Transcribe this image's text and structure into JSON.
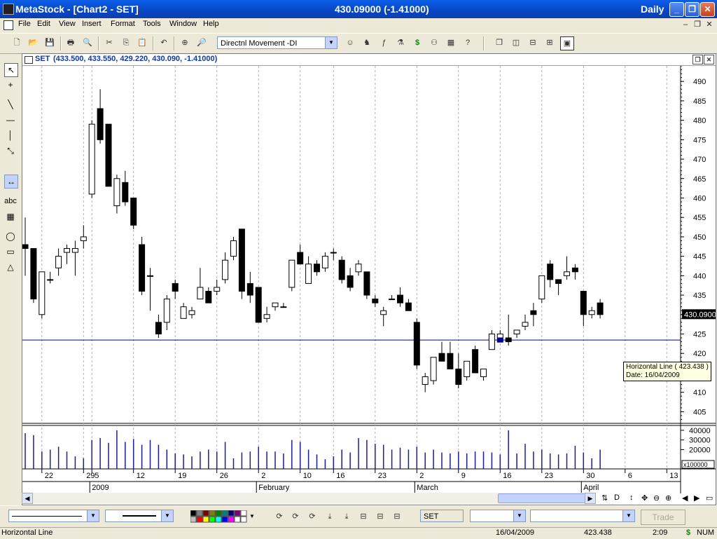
{
  "window": {
    "app_title": "MetaStock - [Chart2 - SET]",
    "center_title": "430.09000 (-1.41000)",
    "periodicity": "Daily"
  },
  "menu": [
    "File",
    "Edit",
    "View",
    "Insert",
    "Format",
    "Tools",
    "Window",
    "Help"
  ],
  "toolbar": {
    "indicator_select": "Directnl Movement -DI"
  },
  "chart_header": {
    "symbol": "SET",
    "ohlc": "(433.500, 433.550, 429.220, 430.090, -1.41000)"
  },
  "chart_data": {
    "type": "candlestick",
    "price_axis": {
      "min": 402,
      "max": 494,
      "ticks": [
        405,
        410,
        415,
        420,
        425,
        430,
        435,
        440,
        445,
        450,
        455,
        460,
        465,
        470,
        475,
        480,
        485,
        490
      ]
    },
    "volume_axis": {
      "ticks_labels": [
        "40000",
        "30000",
        "20000"
      ],
      "unit": "x100000"
    },
    "last_price_label": "430.0900",
    "horizontal_line": 423.438,
    "x_day_labels": [
      "22",
      "29",
      "5",
      "12",
      "19",
      "26",
      "2",
      "10",
      "16",
      "23",
      "2",
      "9",
      "16",
      "23",
      "30",
      "6",
      "13"
    ],
    "x_month_labels": [
      "2009",
      "February",
      "March",
      "April"
    ],
    "candles": [
      {
        "o": 448,
        "h": 455,
        "l": 440,
        "c": 447
      },
      {
        "o": 447,
        "h": 447,
        "l": 433,
        "c": 434
      },
      {
        "o": 430,
        "h": 441,
        "l": 429,
        "c": 441
      },
      {
        "o": 439,
        "h": 441,
        "l": 438,
        "c": 439
      },
      {
        "o": 442,
        "h": 447,
        "l": 440,
        "c": 445
      },
      {
        "o": 446,
        "h": 448,
        "l": 443,
        "c": 447
      },
      {
        "o": 446,
        "h": 449,
        "l": 440,
        "c": 447
      },
      {
        "o": 449,
        "h": 453,
        "l": 447,
        "c": 450
      },
      {
        "o": 461,
        "h": 480,
        "l": 460,
        "c": 479
      },
      {
        "o": 483,
        "h": 488,
        "l": 474,
        "c": 475
      },
      {
        "o": 479,
        "h": 479,
        "l": 463,
        "c": 463
      },
      {
        "o": 458,
        "h": 466,
        "l": 456,
        "c": 465
      },
      {
        "o": 464,
        "h": 467,
        "l": 458,
        "c": 459
      },
      {
        "o": 460,
        "h": 460,
        "l": 452,
        "c": 453
      },
      {
        "o": 448,
        "h": 450,
        "l": 435,
        "c": 436
      },
      {
        "o": 440,
        "h": 442,
        "l": 431,
        "c": 440
      },
      {
        "o": 428,
        "h": 430,
        "l": 424,
        "c": 425
      },
      {
        "o": 428,
        "h": 435,
        "l": 426,
        "c": 434
      },
      {
        "o": 438,
        "h": 439,
        "l": 434,
        "c": 436
      },
      {
        "o": 429,
        "h": 433,
        "l": 429,
        "c": 432
      },
      {
        "o": 430,
        "h": 432,
        "l": 429,
        "c": 431
      },
      {
        "o": 434,
        "h": 442,
        "l": 434,
        "c": 437
      },
      {
        "o": 436,
        "h": 437,
        "l": 433,
        "c": 433
      },
      {
        "o": 436,
        "h": 439,
        "l": 435,
        "c": 437
      },
      {
        "o": 439,
        "h": 446,
        "l": 438,
        "c": 444
      },
      {
        "o": 445,
        "h": 450,
        "l": 444,
        "c": 449
      },
      {
        "o": 452,
        "h": 452,
        "l": 434,
        "c": 436
      },
      {
        "o": 438,
        "h": 441,
        "l": 433,
        "c": 435
      },
      {
        "o": 437,
        "h": 437,
        "l": 428,
        "c": 428
      },
      {
        "o": 429,
        "h": 432,
        "l": 428,
        "c": 430
      },
      {
        "o": 432,
        "h": 433,
        "l": 431,
        "c": 433
      },
      {
        "o": 432,
        "h": 433,
        "l": 432,
        "c": 432
      },
      {
        "o": 437,
        "h": 444,
        "l": 436,
        "c": 444
      },
      {
        "o": 446,
        "h": 448,
        "l": 443,
        "c": 443
      },
      {
        "o": 438,
        "h": 445,
        "l": 438,
        "c": 443
      },
      {
        "o": 443,
        "h": 444,
        "l": 440,
        "c": 441
      },
      {
        "o": 442,
        "h": 446,
        "l": 441,
        "c": 445
      },
      {
        "o": 446,
        "h": 447,
        "l": 444,
        "c": 446
      },
      {
        "o": 444,
        "h": 445,
        "l": 438,
        "c": 439
      },
      {
        "o": 440,
        "h": 442,
        "l": 436,
        "c": 437
      },
      {
        "o": 441,
        "h": 444,
        "l": 440,
        "c": 443
      },
      {
        "o": 441,
        "h": 441,
        "l": 434,
        "c": 435
      },
      {
        "o": 434,
        "h": 435,
        "l": 432,
        "c": 433
      },
      {
        "o": 430,
        "h": 432,
        "l": 427,
        "c": 431
      },
      {
        "o": 434,
        "h": 435,
        "l": 434,
        "c": 434
      },
      {
        "o": 435,
        "h": 437,
        "l": 432,
        "c": 433
      },
      {
        "o": 433,
        "h": 434,
        "l": 431,
        "c": 431
      },
      {
        "o": 428,
        "h": 429,
        "l": 416,
        "c": 417
      },
      {
        "o": 412,
        "h": 415,
        "l": 410,
        "c": 414
      },
      {
        "o": 413,
        "h": 419,
        "l": 412,
        "c": 419
      },
      {
        "o": 420,
        "h": 423,
        "l": 418,
        "c": 418
      },
      {
        "o": 420,
        "h": 423,
        "l": 416,
        "c": 416
      },
      {
        "o": 416,
        "h": 420,
        "l": 411,
        "c": 412
      },
      {
        "o": 414,
        "h": 418,
        "l": 413,
        "c": 418
      },
      {
        "o": 421,
        "h": 422,
        "l": 415,
        "c": 415
      },
      {
        "o": 414,
        "h": 416,
        "l": 413,
        "c": 416
      },
      {
        "o": 421,
        "h": 426,
        "l": 421,
        "c": 425
      },
      {
        "o": 424,
        "h": 426,
        "l": 424,
        "c": 425
      },
      {
        "o": 424,
        "h": 430,
        "l": 422,
        "c": 423
      },
      {
        "o": 425,
        "h": 426,
        "l": 424,
        "c": 426
      },
      {
        "o": 427,
        "h": 430,
        "l": 426,
        "c": 428
      },
      {
        "o": 431,
        "h": 433,
        "l": 427,
        "c": 430
      },
      {
        "o": 434,
        "h": 440,
        "l": 433,
        "c": 440
      },
      {
        "o": 443,
        "h": 444,
        "l": 437,
        "c": 439
      },
      {
        "o": 439,
        "h": 439,
        "l": 435,
        "c": 438
      },
      {
        "o": 440,
        "h": 445,
        "l": 439,
        "c": 441
      },
      {
        "o": 442,
        "h": 443,
        "l": 439,
        "c": 441
      },
      {
        "o": 436,
        "h": 436,
        "l": 427,
        "c": 430
      },
      {
        "o": 430,
        "h": 432,
        "l": 429,
        "c": 431
      },
      {
        "o": 433,
        "h": 434,
        "l": 429,
        "c": 430
      }
    ],
    "volumes": [
      37,
      35,
      18,
      20,
      23,
      18,
      13,
      11,
      30,
      32,
      27,
      40,
      28,
      31,
      25,
      30,
      25,
      20,
      16,
      15,
      13,
      18,
      20,
      18,
      28,
      11,
      17,
      18,
      23,
      18,
      18,
      16,
      30,
      28,
      20,
      15,
      10,
      13,
      20,
      17,
      32,
      30,
      26,
      25,
      20,
      22,
      20,
      23,
      17,
      20,
      17,
      16,
      18,
      16,
      18,
      18,
      17,
      15,
      40,
      16,
      26,
      18,
      20,
      16,
      15,
      16,
      24,
      17,
      11,
      20
    ]
  },
  "tooltip": {
    "line1": "Horizontal Line ( 423.438 )",
    "line2": "Date: 16/04/2009"
  },
  "drawbar": {
    "symbol": "SET",
    "trade_button": "Trade"
  },
  "status": {
    "tool": "Horizontal Line",
    "date": "16/04/2009",
    "value": "423.438",
    "time": "2:09",
    "currency": "$",
    "numlock": "NUM"
  }
}
